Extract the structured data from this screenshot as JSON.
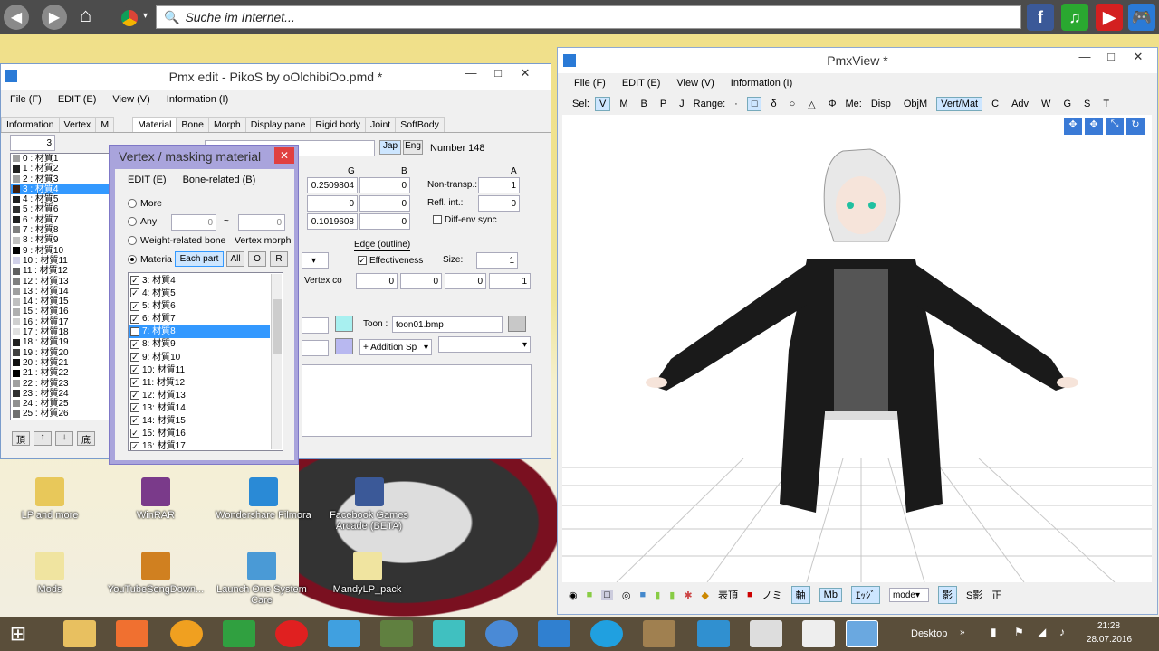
{
  "browser": {
    "search_placeholder": "Suche im Internet...",
    "nav_icons": [
      "back-icon",
      "forward-icon",
      "home-icon",
      "chrome-icon"
    ],
    "bookmark_icons": [
      "facebook-icon",
      "music-icon",
      "youtube-icon",
      "games-icon"
    ]
  },
  "desktop_icons": [
    {
      "label": "LP and more"
    },
    {
      "label": "WinRAR"
    },
    {
      "label": "Wondershare Filmora"
    },
    {
      "label": "Facebook Games Arcade (BETA)"
    },
    {
      "label": "Mods"
    },
    {
      "label": "YouTubeSongDown..."
    },
    {
      "label": "Launch One System Care"
    },
    {
      "label": "MandyLP_pack"
    }
  ],
  "pmx_edit": {
    "title": "Pmx edit - PikoS by oOlchibiOo.pmd *",
    "menu": [
      "File (F)",
      "EDIT (E)",
      "View (V)",
      "Information (I)"
    ],
    "tabs": [
      "Information",
      "Vertex",
      "M",
      "Material",
      "Bone",
      "Morph",
      "Display pane",
      "Rigid body",
      "Joint",
      "SoftBody"
    ],
    "active_tab": "Material",
    "index_value": "3",
    "lang_jap": "Jap",
    "lang_eng": "Eng",
    "number_label": "Number 148",
    "materials": [
      {
        "label": "0 : 材質1",
        "color": "#a0a0a0"
      },
      {
        "label": "1 : 材質2",
        "color": "#202020"
      },
      {
        "label": "2 : 材質3",
        "color": "#a0a0a0"
      },
      {
        "label": "3 : 材質4",
        "color": "#402010"
      },
      {
        "label": "4 : 材質5",
        "color": "#202020"
      },
      {
        "label": "5 : 材質6",
        "color": "#303030"
      },
      {
        "label": "6 : 材質7",
        "color": "#202020"
      },
      {
        "label": "7 : 材質8",
        "color": "#808080"
      },
      {
        "label": "8 : 材質9",
        "color": "#c0c0c0"
      },
      {
        "label": "9 : 材質10",
        "color": "#000000"
      },
      {
        "label": "10 : 材質11",
        "color": "#d0d0e8"
      },
      {
        "label": "11 : 材質12",
        "color": "#606060"
      },
      {
        "label": "12 : 材質13",
        "color": "#808080"
      },
      {
        "label": "13 : 材質14",
        "color": "#a0a0a0"
      },
      {
        "label": "14 : 材質15",
        "color": "#c0c0c0"
      },
      {
        "label": "15 : 材質16",
        "color": "#b0b0b0"
      },
      {
        "label": "16 : 材質17",
        "color": "#d0d0d0"
      },
      {
        "label": "17 : 材質18",
        "color": "#e0e0e0"
      },
      {
        "label": "18 : 材質19",
        "color": "#202020"
      },
      {
        "label": "19 : 材質20",
        "color": "#404040"
      },
      {
        "label": "20 : 材質21",
        "color": "#101010"
      },
      {
        "label": "21 : 材質22",
        "color": "#000000"
      },
      {
        "label": "22 : 材質23",
        "color": "#a0a0a0"
      },
      {
        "label": "23 : 材質24",
        "color": "#303030"
      },
      {
        "label": "24 : 材質25",
        "color": "#909090"
      },
      {
        "label": "25 : 材質26",
        "color": "#707070"
      }
    ],
    "selected_material_index": 3,
    "list_buttons": [
      "頂",
      "↑",
      "↓",
      "底"
    ],
    "col_headers": {
      "g": "G",
      "b": "B",
      "a": "A"
    },
    "rows": [
      {
        "g": "0.2509804",
        "b": "0",
        "label": "Non-transp.:",
        "a": "1"
      },
      {
        "g": "0",
        "b": "0",
        "label": "Refl. int.:",
        "a": "0"
      },
      {
        "g": "0.1019608",
        "b": "0"
      }
    ],
    "diff_env_sync": "Diff-env sync",
    "edge_title": "Edge (outline)",
    "effectiveness": "Effectiveness",
    "size_label": "Size:",
    "size_value": "1",
    "edge_color": [
      "0",
      "0",
      "0",
      "1"
    ],
    "vertex_co": "Vertex co",
    "toon_label": "Toon :",
    "toon_value": "toon01.bmp",
    "sphere_mode": "+ Addition Sp"
  },
  "dialog": {
    "title": "Vertex / masking material",
    "menu": [
      "EDIT (E)",
      "Bone-related (B)"
    ],
    "opt_more": "More",
    "opt_any": "Any",
    "any_from": "0",
    "any_tilde": "~",
    "any_to": "0",
    "opt_weight": "Weight-related bone",
    "opt_vertex_morph": "Vertex morph",
    "opt_material": "Materia",
    "btn_each": "Each part",
    "btn_all": "All",
    "btn_o": "O",
    "btn_r": "R",
    "items": [
      "3: 材質4",
      "4: 材質5",
      "5: 材質6",
      "6: 材質7",
      "7: 材質8",
      "8: 材質9",
      "9: 材質10",
      "10: 材質11",
      "11: 材質12",
      "12: 材質13",
      "13: 材質14",
      "14: 材質15",
      "15: 材質16",
      "16: 材質17"
    ],
    "selected_item": 4
  },
  "pmxview": {
    "title": "PmxView *",
    "menu": [
      "File (F)",
      "EDIT (E)",
      "View (V)",
      "Information (I)"
    ],
    "toolbar": {
      "sel_label": "Sel:",
      "sel_items": [
        "V",
        "M",
        "B",
        "P",
        "J"
      ],
      "range_label": "Range:",
      "range_items": [
        "·",
        "□",
        "δ",
        "○",
        "△",
        "Φ"
      ],
      "me_label": "Me:",
      "me_items": [
        "Disp",
        "ObjM",
        "Vert/Mat",
        "C",
        "Adv",
        "W",
        "G",
        "S",
        "T"
      ]
    },
    "bottom": {
      "hyo": "表頂",
      "nomi": "ノミ",
      "axis": "軸",
      "mb": "Mb",
      "edge": "ｴｯｼﾞ",
      "mode": "mode",
      "shadow": "影",
      "sshadow": "S影",
      "sei": "正"
    }
  },
  "taskbar": {
    "desktop_label": "Desktop",
    "time": "21:28",
    "date": "28.07.2016"
  }
}
